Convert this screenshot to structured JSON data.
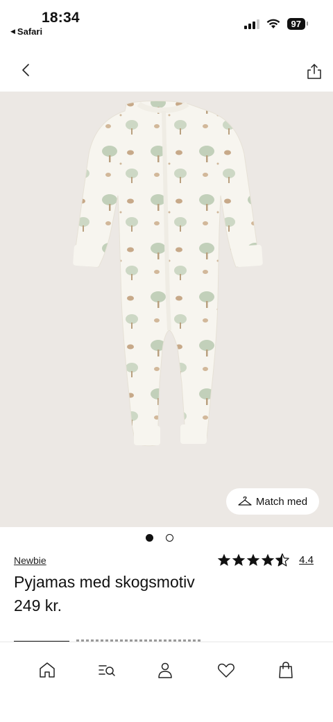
{
  "status_bar": {
    "time": "18:34",
    "back_app": "Safari",
    "battery": "97"
  },
  "nav": {
    "back_icon": "chevron-left-icon",
    "share_icon": "share-icon"
  },
  "gallery": {
    "image_alt": "Pyjamas med skogsmotiv",
    "match_label": "Match med",
    "slide_count": 2,
    "active_slide": 1
  },
  "product": {
    "brand": "Newbie",
    "title": "Pyjamas med skogsmotiv",
    "price": "249 kr.",
    "rating": "4.4",
    "stars_filled": 4.4,
    "stars_total": 5
  },
  "tab_bar": {
    "items": [
      {
        "icon": "home-icon"
      },
      {
        "icon": "search-filter-icon"
      },
      {
        "icon": "account-icon"
      },
      {
        "icon": "heart-icon"
      },
      {
        "icon": "shopping-bag-icon"
      }
    ]
  },
  "colors": {
    "image_bg": "#ece8e4",
    "text": "#111111"
  }
}
